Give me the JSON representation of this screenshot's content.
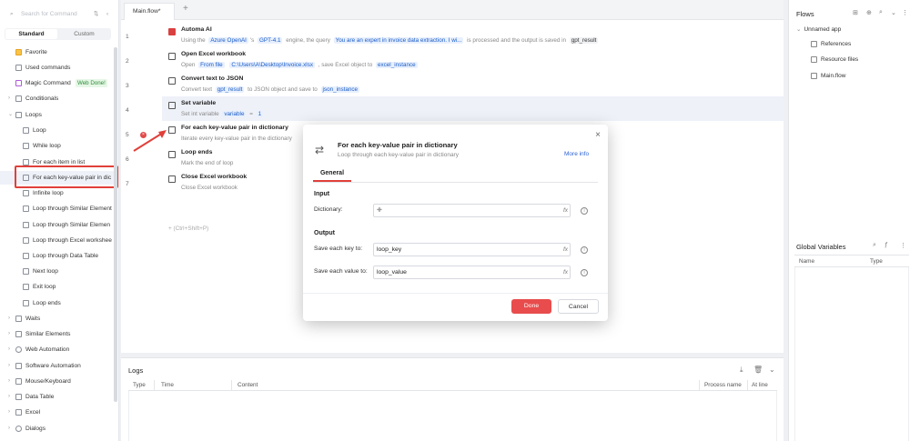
{
  "left": {
    "search_placeholder": "Search for Command",
    "tabs": [
      "Standard",
      "Custom"
    ],
    "items": [
      {
        "label": "Favorite"
      },
      {
        "label": "Used commands"
      },
      {
        "label": "Magic Command",
        "badge": "Web Done!"
      },
      {
        "label": "Conditionals"
      },
      {
        "label": "Loops"
      },
      {
        "label": "Loop"
      },
      {
        "label": "While loop"
      },
      {
        "label": "For each item in list"
      },
      {
        "label": "For each key-value pair in dic"
      },
      {
        "label": "Infinite loop"
      },
      {
        "label": "Loop through Similar Element"
      },
      {
        "label": "Loop through Similar Elemen"
      },
      {
        "label": "Loop through Excel workshee"
      },
      {
        "label": "Loop through Data Table"
      },
      {
        "label": "Next loop"
      },
      {
        "label": "Exit loop"
      },
      {
        "label": "Loop ends"
      },
      {
        "label": "Waits"
      },
      {
        "label": "Similar Elements"
      },
      {
        "label": "Web Automation"
      },
      {
        "label": "Software Automation"
      },
      {
        "label": "Mouse/Keyboard"
      },
      {
        "label": "Data Table"
      },
      {
        "label": "Excel"
      },
      {
        "label": "Dialogs"
      }
    ]
  },
  "editor": {
    "file_tab": "Main.flow*",
    "line_numbers": [
      "1",
      "2",
      "3",
      "4",
      "5",
      "6",
      "7"
    ],
    "steps": [
      {
        "title": "Automa AI",
        "desc": [
          "Using the ",
          "Azure OpenAI",
          "'s ",
          "GPT-4.1",
          " engine, the query ",
          "You are an expert in invoice data extraction. I wi...",
          " is processed and the output is saved in ",
          "gpt_result"
        ]
      },
      {
        "title": "Open Excel workbook",
        "desc": [
          "Open ",
          "From file",
          " ",
          "C:\\Users\\A\\Desktop\\Invoice.xlsx",
          " , save Excel object to ",
          "excel_instance"
        ]
      },
      {
        "title": "Convert text to JSON",
        "desc": [
          "Convert text ",
          "gpt_result",
          " to JSON object and save to ",
          "json_instance"
        ]
      },
      {
        "title": "Set variable",
        "desc": [
          "Set int variable ",
          "variable",
          " = ",
          "1"
        ]
      },
      {
        "title": "For each key-value pair in dictionary",
        "desc": [
          "Iterate every key-value pair in the dictionary"
        ]
      },
      {
        "title": "Loop ends",
        "desc": [
          "Mark the end of loop"
        ]
      },
      {
        "title": "Close Excel workbook",
        "desc": [
          "Close Excel workbook"
        ]
      }
    ],
    "add_hint": "(Ctrl+Shift+P)"
  },
  "logs": {
    "title": "Logs",
    "columns": [
      "Type",
      "Time",
      "Content",
      "Process name",
      "At line"
    ]
  },
  "right": {
    "flows_title": "Flows",
    "app_name": "Unnamed app",
    "flow_items": [
      "References",
      "Resource files",
      "Main.flow"
    ],
    "gv_title": "Global Variables",
    "gv_columns": [
      "Name",
      "Type"
    ]
  },
  "dialog": {
    "title": "For each key-value pair in dictionary",
    "subtitle": "Loop through each key-value pair in dictionary",
    "more_info": "More info",
    "tab": "General",
    "input_section": "Input",
    "dictionary_label": "Dictionary:",
    "output_section": "Output",
    "key_label": "Save each key to:",
    "key_value": "loop_key",
    "value_label": "Save each value to:",
    "value_value": "loop_value",
    "fx": "fx",
    "done": "Done",
    "cancel": "Cancel"
  },
  "colors": {
    "accent": "#e84c4c",
    "chip_bg": "#e8f0fd",
    "chip_text": "#1a5cc8",
    "selected_row": "#eef1f8"
  }
}
